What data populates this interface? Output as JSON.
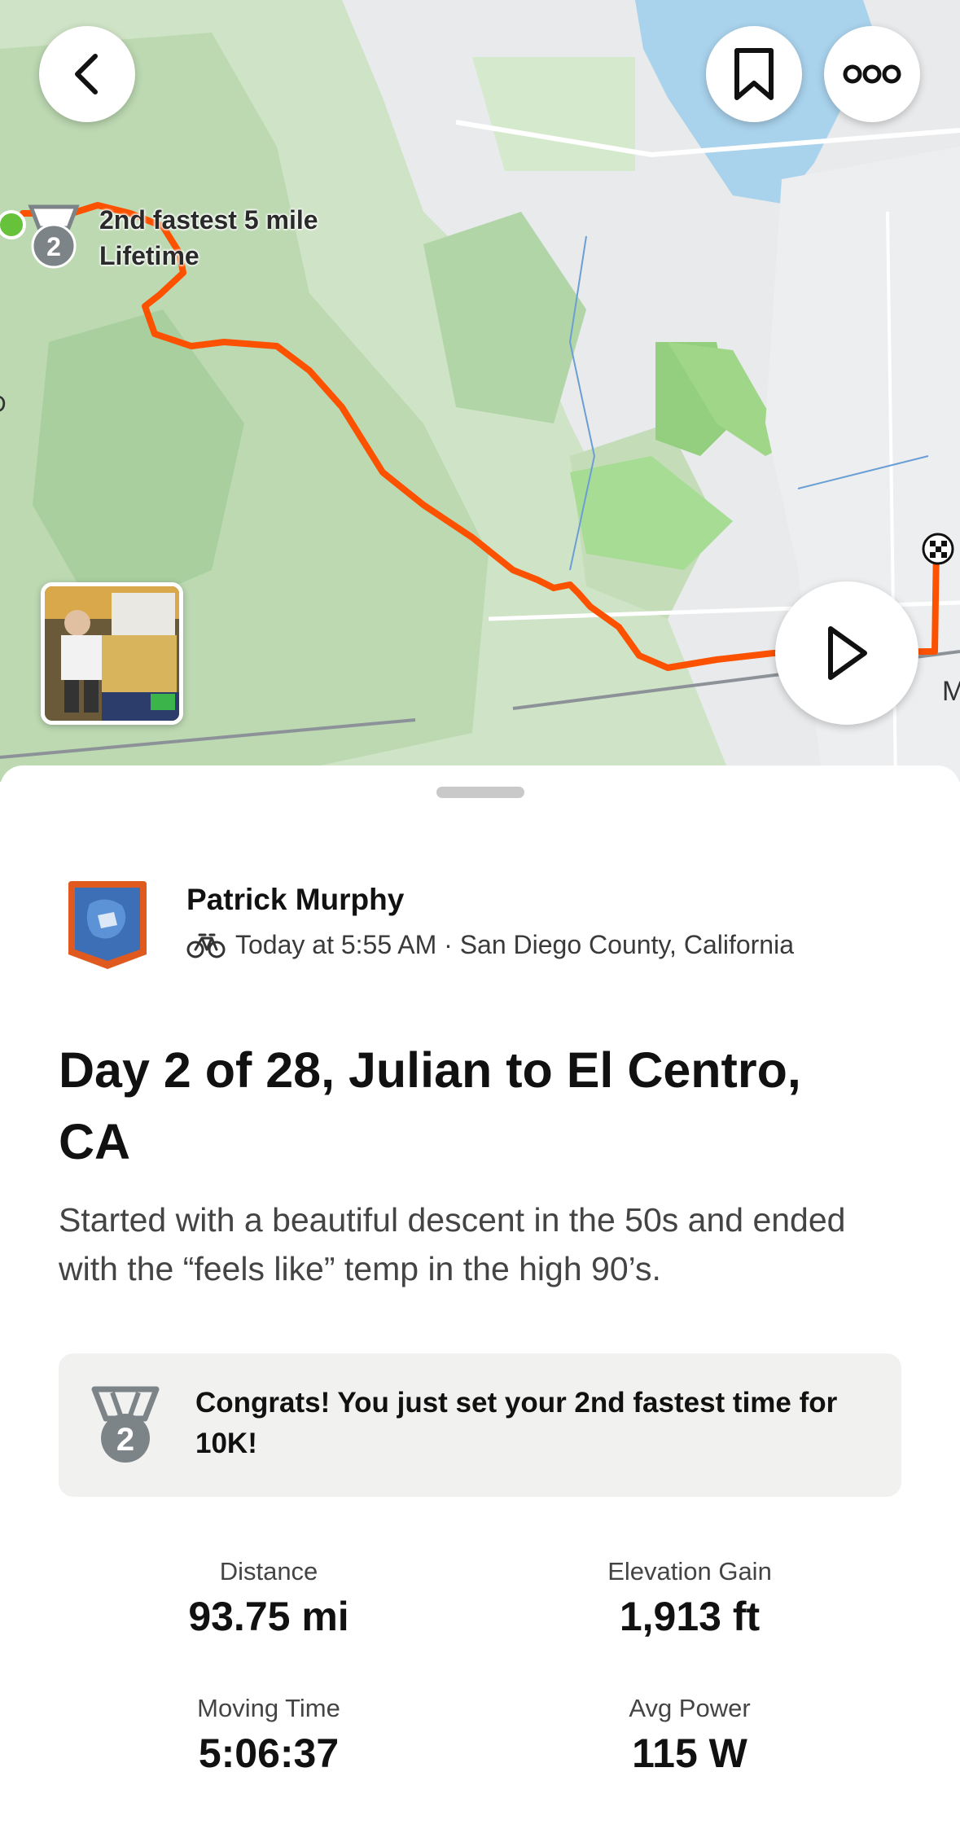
{
  "map": {
    "achievement_label_line1": "2nd fastest 5 mile",
    "achievement_label_line2": "Lifetime",
    "edge_label_right": "M",
    "edge_label_left": "D",
    "route_color": "#fc5200",
    "start_marker_color": "#66c23a"
  },
  "top_bar": {
    "back_icon": "chevron-left-icon",
    "bookmark_icon": "bookmark-icon",
    "more_icon": "more-horizontal-icon"
  },
  "play_icon": "play-icon",
  "athlete": {
    "name": "Patrick Murphy",
    "activity_icon": "bike-icon",
    "meta": "Today at 5:55 AM · San Diego County, California"
  },
  "activity": {
    "title": "Day 2 of 28, Julian to El Centro, CA",
    "description": "Started with a beautiful descent in the 50s and ended with the “feels like” temp in the high 90’s."
  },
  "congrats": {
    "medal_icon": "silver-medal-icon",
    "medal_rank": "2",
    "text": "Congrats! You just set your 2nd fastest time for 10K!"
  },
  "stats": [
    {
      "label": "Distance",
      "value": "93.75 mi"
    },
    {
      "label": "Elevation Gain",
      "value": "1,913 ft"
    },
    {
      "label": "Moving Time",
      "value": "5:06:37"
    },
    {
      "label": "Avg Power",
      "value": "115 W"
    }
  ]
}
